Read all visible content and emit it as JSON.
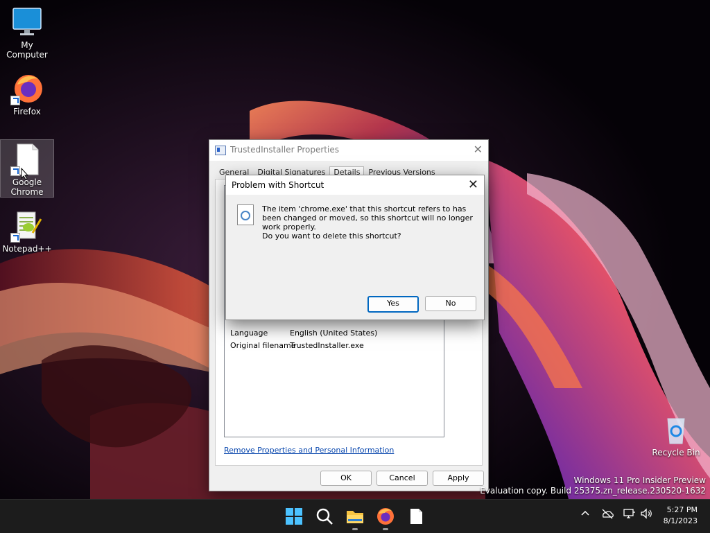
{
  "desktop": {
    "icons": [
      {
        "label": "My Computer"
      },
      {
        "label": "Firefox"
      },
      {
        "label": "Google Chrome"
      },
      {
        "label": "Notepad++"
      },
      {
        "label": "Recycle Bin"
      }
    ],
    "watermark": {
      "line1": "Windows 11 Pro Insider Preview",
      "line2": "Evaluation copy. Build 25375.zn_release.230520-1632"
    }
  },
  "properties_window": {
    "title": "TrustedInstaller Properties",
    "tabs": [
      {
        "label": "General"
      },
      {
        "label": "Digital Signatures"
      },
      {
        "label": "Details",
        "active": true
      },
      {
        "label": "Previous Versions"
      }
    ],
    "details": [
      {
        "name": "Language",
        "value": "English (United States)"
      },
      {
        "name": "Original filename",
        "value": "TrustedInstaller.exe"
      }
    ],
    "remove_link": "Remove Properties and Personal Information",
    "buttons": {
      "ok": "OK",
      "cancel": "Cancel",
      "apply": "Apply"
    }
  },
  "message_box": {
    "title": "Problem with Shortcut",
    "message": "The item 'chrome.exe' that this shortcut refers to has been changed or moved, so this shortcut will no longer work properly.",
    "question": "Do you want to delete this shortcut?",
    "buttons": {
      "yes": "Yes",
      "no": "No"
    }
  },
  "taskbar": {
    "time": "5:27 PM",
    "date": "8/1/2023"
  },
  "colors": {
    "accent": "#0067c0",
    "taskbar": "#1c1c1c"
  }
}
